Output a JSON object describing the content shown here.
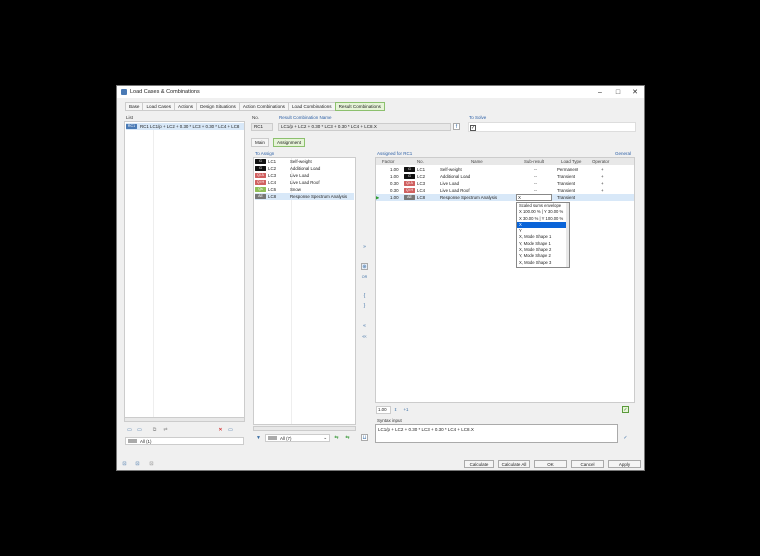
{
  "window": {
    "title": "Load Cases & Combinations",
    "minimize": "–",
    "maximize": "□",
    "close": "✕"
  },
  "tabs": [
    "Base",
    "Load Cases",
    "Actions",
    "Design Situations",
    "Action Combinations",
    "Load Combinations",
    "Result Combinations"
  ],
  "active_tab": "Result Combinations",
  "list": {
    "header": "List",
    "item_badge": "RC1",
    "item_text": "RC1  LC1/p + LC2 + 0.30 * LC3 + 0.30 * LC4 + LC8",
    "filter": "All (1)"
  },
  "no": {
    "label": "No.",
    "value": "RC1"
  },
  "name": {
    "label": "Result Combination Name",
    "value": "LC1/p + LC2 + 0.30 * LC3 + 0.30 * LC4 + LC8.X"
  },
  "to_solve": {
    "label": "To Solve",
    "checked": "✓"
  },
  "subtabs": [
    "Main",
    "Assignment"
  ],
  "to_assign": {
    "header": "To Assign",
    "items": [
      {
        "badge": "G",
        "code": "LC1",
        "name": "Self-weight",
        "color": "#111111"
      },
      {
        "badge": "G",
        "code": "LC2",
        "name": "Additional Load",
        "color": "#111111"
      },
      {
        "badge": "Qi A",
        "code": "LC3",
        "name": "Live Load",
        "color": "#d06060"
      },
      {
        "badge": "Qi H",
        "code": "LC4",
        "name": "Live Load Roof",
        "color": "#d06060"
      },
      {
        "badge": "Qs",
        "code": "LC6",
        "name": "Snow",
        "color": "#8fbf5a"
      },
      {
        "badge": "AE",
        "code": "LC8",
        "name": "Response Spectrum Analysis",
        "color": "#777777"
      }
    ],
    "filter": "All (7)"
  },
  "mid_buttons": {
    "add": "»",
    "add_all": "⊕",
    "or": "OR",
    "brace_open": "{",
    "brace_close": "}",
    "remove": "«",
    "remove_all": "«‹"
  },
  "assigned": {
    "header": "Assigned for RC1",
    "general": "General",
    "columns": [
      "Factor",
      "No.",
      "Name",
      "Sub-result",
      "Load Type",
      "Operator"
    ],
    "rows": [
      {
        "factor": "1.00",
        "badge": "G",
        "code": "LC1",
        "name": "Self-weight",
        "sub": "--",
        "type": "Permanent",
        "op": "+",
        "color": "#111111"
      },
      {
        "factor": "1.00",
        "badge": "G",
        "code": "LC2",
        "name": "Additional Load",
        "sub": "--",
        "type": "Transient",
        "op": "+",
        "color": "#111111"
      },
      {
        "factor": "0.30",
        "badge": "Qi A",
        "code": "LC3",
        "name": "Live Load",
        "sub": "--",
        "type": "Transient",
        "op": "+",
        "color": "#d06060"
      },
      {
        "factor": "0.30",
        "badge": "Qi H",
        "code": "LC4",
        "name": "Live Load Roof",
        "sub": "--",
        "type": "Transient",
        "op": "+",
        "color": "#d06060"
      },
      {
        "factor": "1.00",
        "badge": "AE",
        "code": "LC8",
        "name": "Response Spectrum Analysis",
        "sub": "X",
        "type": "Transient",
        "op": "",
        "color": "#777777"
      }
    ],
    "dropdown": [
      "Scaled sums envelope",
      "X 100.00 % | Y 30.00 %",
      "X 30.00 % | Y 100.00 %",
      "X",
      "Y",
      "X, Mode Shape 1",
      "Y, Mode Shape 1",
      "X, Mode Shape 2",
      "Y, Mode Shape 2",
      "X, Mode Shape 3"
    ],
    "dropdown_selected": 3,
    "factor_value": "1.00",
    "increment": "+1"
  },
  "syntax": {
    "label": "Syntax input",
    "value": "LC1/p + LC2 + 0.30 * LC3 + 0.30 * LC4 + LC8.X"
  },
  "footer": {
    "calculate": "Calculate",
    "calculate_all": "Calculate All",
    "ok": "OK",
    "cancel": "Cancel",
    "apply": "Apply"
  }
}
